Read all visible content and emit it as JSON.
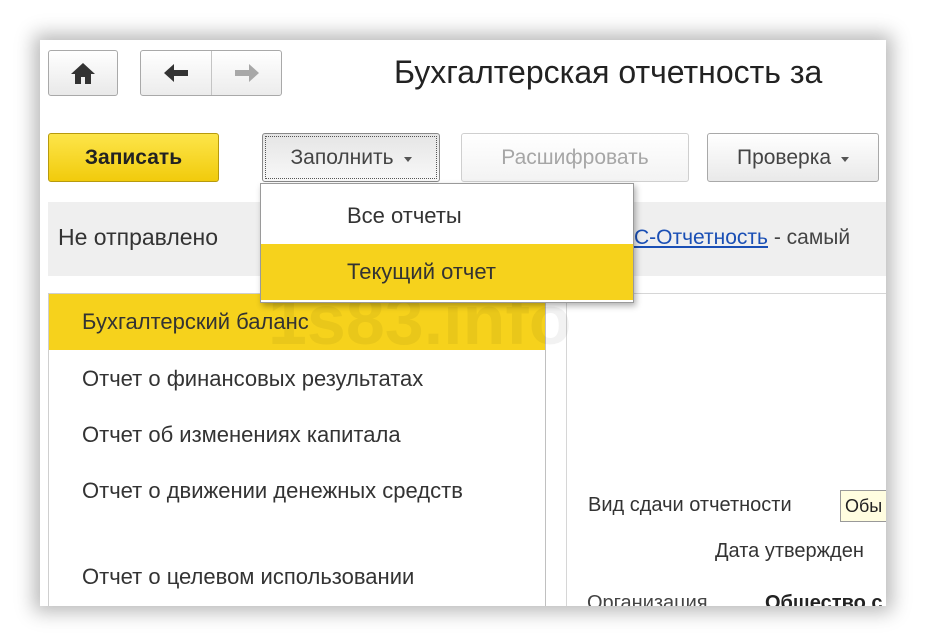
{
  "header": {
    "title": "Бухгалтерская отчетность за"
  },
  "nav": {
    "home_icon": "home-icon",
    "back_icon": "arrow-left-icon",
    "forward_icon": "arrow-right-icon"
  },
  "toolbar": {
    "save_label": "Записать",
    "fill_label": "Заполнить",
    "decode_label": "Расшифровать",
    "check_label": "Проверка"
  },
  "fill_menu": {
    "items": [
      "Все отчеты",
      "Текущий отчет"
    ],
    "highlighted": "Текущий отчет"
  },
  "status_bar": {
    "status_text": "Не отправлено",
    "link_text": "С-Отчетность",
    "suffix_text": " - самый"
  },
  "report_list": {
    "items": [
      "Бухгалтерский баланс",
      "Отчет о финансовых результатах",
      "Отчет об изменениях капитала",
      "Отчет о движении денежных средств",
      "Отчет о целевом использовании"
    ],
    "selected": "Бухгалтерский баланс"
  },
  "form": {
    "submission_type_label": "Вид сдачи отчетности",
    "submission_type_value": "Обы",
    "approval_date_label": "Дата утвержден",
    "organization_label": "Организация",
    "organization_value": "Общество с"
  },
  "watermark": "1s83.info",
  "colors": {
    "accent": "#f6d21c",
    "link": "#1a4fb5"
  }
}
